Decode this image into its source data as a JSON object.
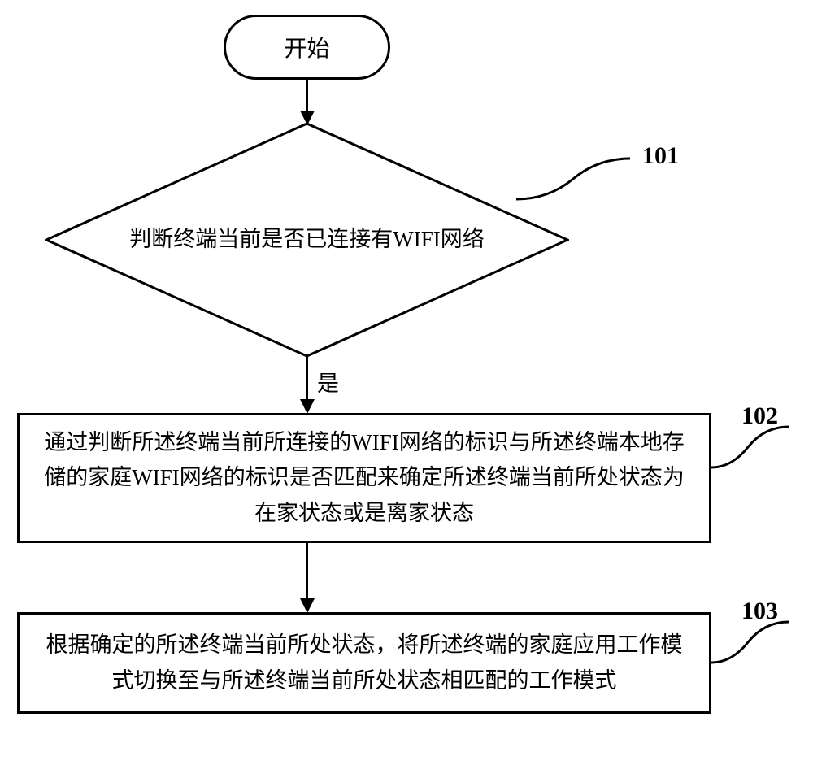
{
  "start": {
    "label": "开始"
  },
  "diamond": {
    "text": "判断终端当前是否已连接有WIFI网络"
  },
  "step2": {
    "text": "通过判断所述终端当前所连接的WIFI网络的标识与所述终端本地存储的家庭WIFI网络的标识是否匹配来确定所述终端当前所处状态为在家状态或是离家状态"
  },
  "step3": {
    "text": "根据确定的所述终端当前所处状态，将所述终端的家庭应用工作模式切换至与所述终端当前所处状态相匹配的工作模式"
  },
  "edge_yes": "是",
  "labels": {
    "l101": "101",
    "l102": "102",
    "l103": "103"
  }
}
